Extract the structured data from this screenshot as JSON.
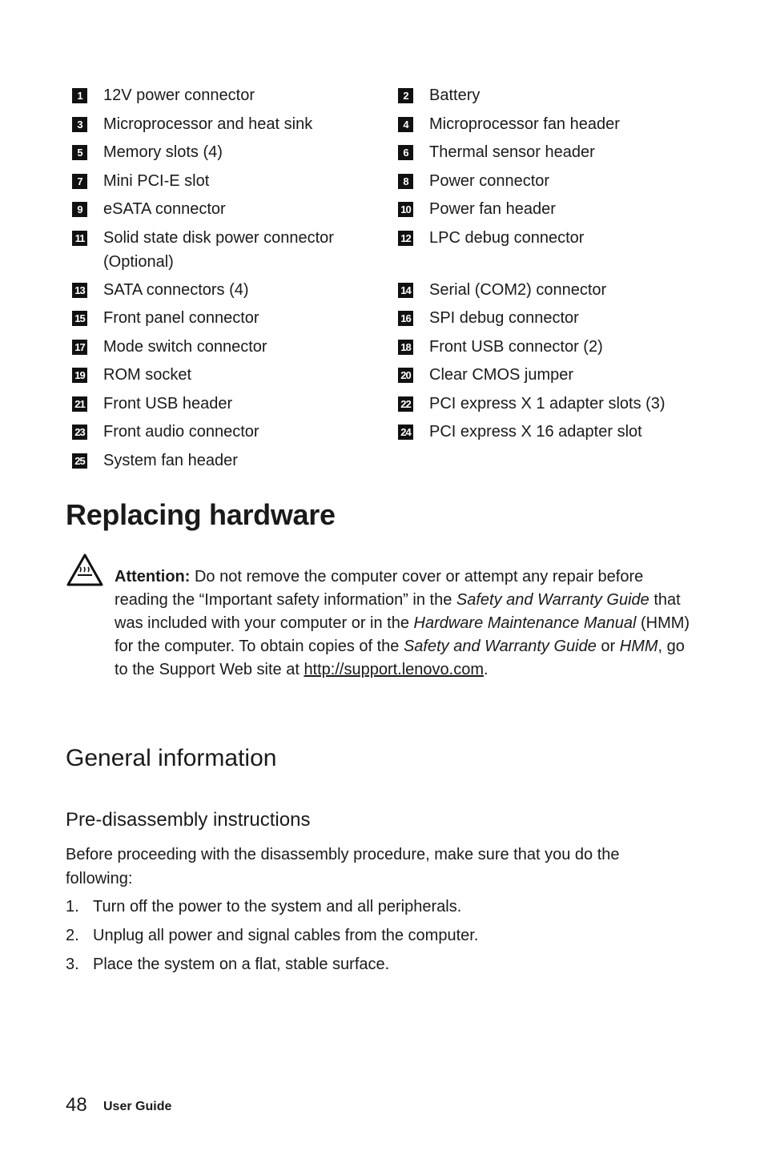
{
  "legend": {
    "rows": [
      [
        {
          "num": "1",
          "label": "12V power connector"
        },
        {
          "num": "2",
          "label": "Battery"
        }
      ],
      [
        {
          "num": "3",
          "label": "Microprocessor and heat sink"
        },
        {
          "num": "4",
          "label": "Microprocessor fan header"
        }
      ],
      [
        {
          "num": "5",
          "label": "Memory slots (4)"
        },
        {
          "num": "6",
          "label": "Thermal sensor header"
        }
      ],
      [
        {
          "num": "7",
          "label": "Mini PCI-E slot"
        },
        {
          "num": "8",
          "label": "Power connector"
        }
      ],
      [
        {
          "num": "9",
          "label": "eSATA connector"
        },
        {
          "num": "10",
          "label": "Power fan header"
        }
      ],
      [
        {
          "num": "11",
          "label": "Solid state disk power connector (Optional)"
        },
        {
          "num": "12",
          "label": "LPC debug connector"
        }
      ],
      [
        {
          "num": "13",
          "label": "SATA connectors (4)"
        },
        {
          "num": "14",
          "label": "Serial (COM2) connector"
        }
      ],
      [
        {
          "num": "15",
          "label": "Front panel connector"
        },
        {
          "num": "16",
          "label": "SPI debug connector"
        }
      ],
      [
        {
          "num": "17",
          "label": "Mode switch connector"
        },
        {
          "num": "18",
          "label": "Front USB connector (2)"
        }
      ],
      [
        {
          "num": "19",
          "label": "ROM socket"
        },
        {
          "num": "20",
          "label": "Clear CMOS jumper"
        }
      ],
      [
        {
          "num": "21",
          "label": "Front USB header"
        },
        {
          "num": "22",
          "label": "PCI express X 1 adapter slots (3)"
        }
      ],
      [
        {
          "num": "23",
          "label": "Front audio connector"
        },
        {
          "num": "24",
          "label": "PCI express X 16 adapter slot"
        }
      ],
      [
        {
          "num": "25",
          "label": "System fan header"
        }
      ]
    ]
  },
  "title": "Replacing hardware",
  "attention": {
    "icon": "hot-surface-warning-icon",
    "label": "Attention:",
    "t1": " Do not remove the computer cover or attempt any repair before reading the “Important safety information” in the ",
    "i1": "Safety and Warranty Guide",
    "t2": " that was included with your computer or in the ",
    "i2": "Hardware Maintenance Manual",
    "t3": " (HMM) for the computer. To obtain copies of the ",
    "i3": "Safety and Warranty Guide",
    "t4": " or ",
    "i4": "HMM",
    "t5": ", go to the Support Web site at ",
    "link": "http://support.lenovo.com",
    "t6": "."
  },
  "section_title": "General information",
  "subsection_title": "Pre-disassembly instructions",
  "intro": "Before proceeding with the disassembly procedure, make sure that you do the following:",
  "steps": [
    {
      "num": "1.",
      "text": "Turn off the power to the system and all peripherals."
    },
    {
      "num": "2.",
      "text": "Unplug all power and signal cables from the computer."
    },
    {
      "num": "3.",
      "text": "Place the system on a flat, stable surface."
    }
  ],
  "footer": {
    "page": "48",
    "label": "User Guide"
  }
}
